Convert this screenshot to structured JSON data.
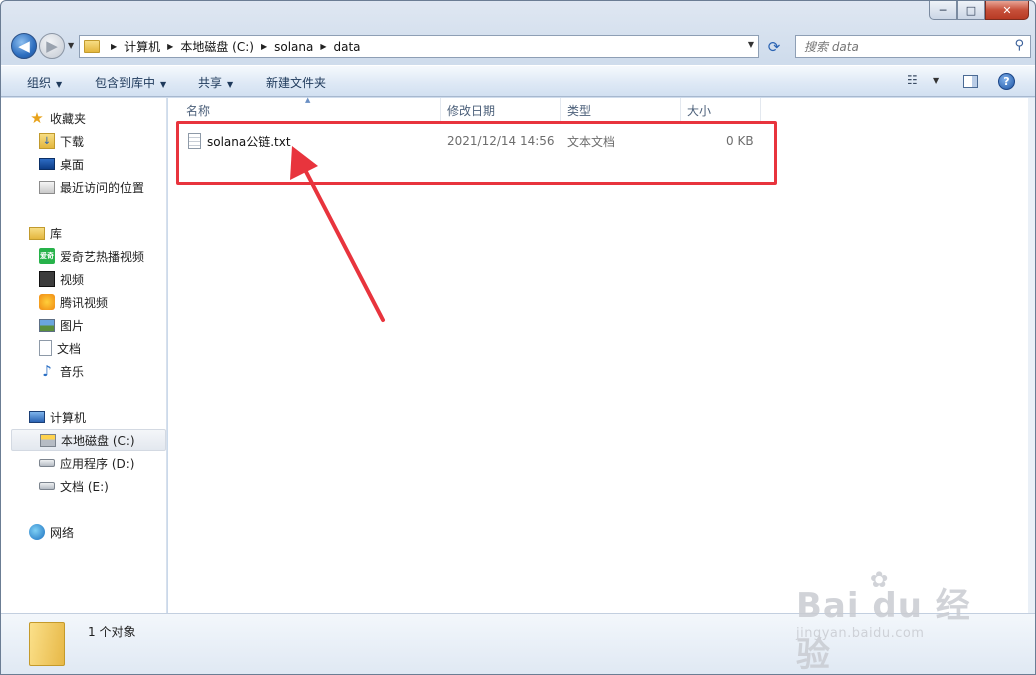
{
  "window": {
    "caption": {
      "minimize": "─",
      "maximize": "□",
      "close": "✕"
    }
  },
  "nav": {
    "back_icon": "◀",
    "forward_icon": "▶",
    "breadcrumb": [
      "计算机",
      "本地磁盘 (C:)",
      "solana",
      "data"
    ],
    "search_placeholder": "搜索 data"
  },
  "toolbar": {
    "organize": "组织",
    "include_library": "包含到库中",
    "share": "共享",
    "new_folder": "新建文件夹",
    "help": "?"
  },
  "sidebar": {
    "favorites": {
      "label": "收藏夹",
      "items": [
        "下载",
        "桌面",
        "最近访问的位置"
      ]
    },
    "libraries": {
      "label": "库",
      "items": [
        "爱奇艺热播视频",
        "视频",
        "腾讯视频",
        "图片",
        "文档",
        "音乐"
      ]
    },
    "computer": {
      "label": "计算机",
      "items": [
        "本地磁盘 (C:)",
        "应用程序 (D:)",
        "文档 (E:)"
      ]
    },
    "network": {
      "label": "网络"
    },
    "iqiyi_badge": "爱奇"
  },
  "columns": {
    "name": "名称",
    "date": "修改日期",
    "type": "类型",
    "size": "大小"
  },
  "files": [
    {
      "name": "solana公链.txt",
      "date": "2021/12/14 14:56",
      "type": "文本文档",
      "size": "0 KB"
    }
  ],
  "status": {
    "count": "1 个对象"
  },
  "watermark": {
    "main": "Bai du 经验",
    "sub": "jingyan.baidu.com"
  },
  "colors": {
    "highlight": "#e8343d",
    "accent": "#2a63b3"
  }
}
